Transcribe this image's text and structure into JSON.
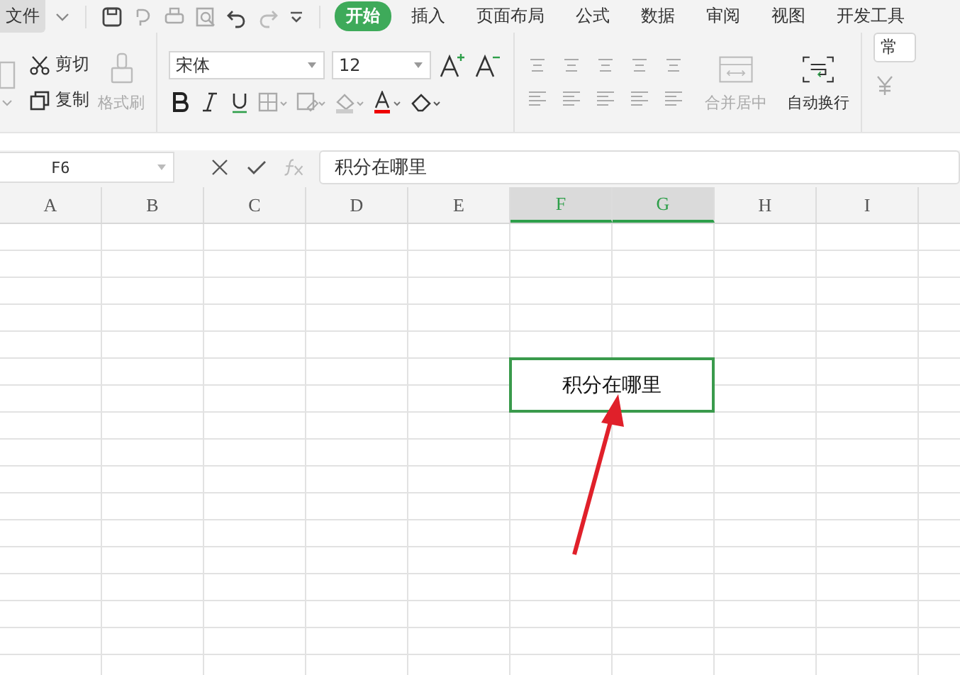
{
  "menu": {
    "file": "文件"
  },
  "tabs": [
    {
      "label": "开始",
      "selected": true
    },
    {
      "label": "插入",
      "selected": false
    },
    {
      "label": "页面布局",
      "selected": false
    },
    {
      "label": "公式",
      "selected": false
    },
    {
      "label": "数据",
      "selected": false
    },
    {
      "label": "审阅",
      "selected": false
    },
    {
      "label": "视图",
      "selected": false
    },
    {
      "label": "开发工具",
      "selected": false
    }
  ],
  "ribbon": {
    "clipboard": [
      {
        "label": "剪切",
        "disabled": false
      },
      {
        "label": "复制",
        "disabled": false
      },
      {
        "label": "格式刷",
        "disabled": true
      }
    ],
    "font_name": "宋体",
    "font_size": "12",
    "merge": {
      "label": "合并居中",
      "disabled": true
    },
    "wrap": {
      "label": "自动换行",
      "disabled": false
    },
    "number_format": "常"
  },
  "formula_bar": {
    "cell_ref": "F6",
    "value": "积分在哪里"
  },
  "columns": [
    {
      "label": "A",
      "selected": false
    },
    {
      "label": "B",
      "selected": false
    },
    {
      "label": "C",
      "selected": false
    },
    {
      "label": "D",
      "selected": false
    },
    {
      "label": "E",
      "selected": false
    },
    {
      "label": "F",
      "selected": true
    },
    {
      "label": "G",
      "selected": true
    },
    {
      "label": "H",
      "selected": false
    },
    {
      "label": "I",
      "selected": false
    }
  ],
  "cell": {
    "text": "积分在哪里"
  }
}
